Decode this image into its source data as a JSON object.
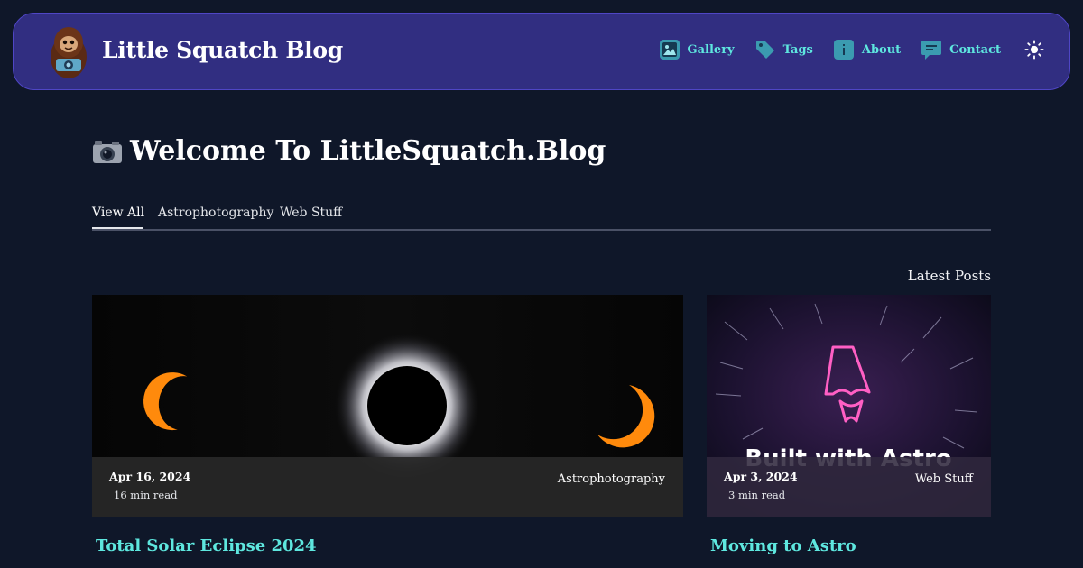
{
  "header": {
    "brand": "Little Squatch Blog",
    "nav": [
      {
        "label": "Gallery",
        "icon": "gallery-icon"
      },
      {
        "label": "Tags",
        "icon": "tag-icon"
      },
      {
        "label": "About",
        "icon": "info-icon"
      },
      {
        "label": "Contact",
        "icon": "chat-icon"
      }
    ],
    "theme_toggle_icon": "sun-icon"
  },
  "main": {
    "title_icon": "camera-icon",
    "title": "Welcome To LittleSquatch.Blog",
    "tabs": [
      "View All",
      "Astrophotography",
      "Web Stuff"
    ],
    "active_tab": "View All",
    "latest_label": "Latest Posts"
  },
  "posts": [
    {
      "date": "Apr 16, 2024",
      "read_time": "16 min read",
      "category": "Astrophotography",
      "title": "Total Solar Eclipse 2024"
    },
    {
      "date": "Apr 3, 2024",
      "read_time": "3 min read",
      "category": "Web Stuff",
      "title": "Moving to Astro",
      "image_text": "Built with Astro"
    }
  ],
  "colors": {
    "background": "#0f1729",
    "header": "#312e81",
    "accent": "#5ee7df"
  }
}
